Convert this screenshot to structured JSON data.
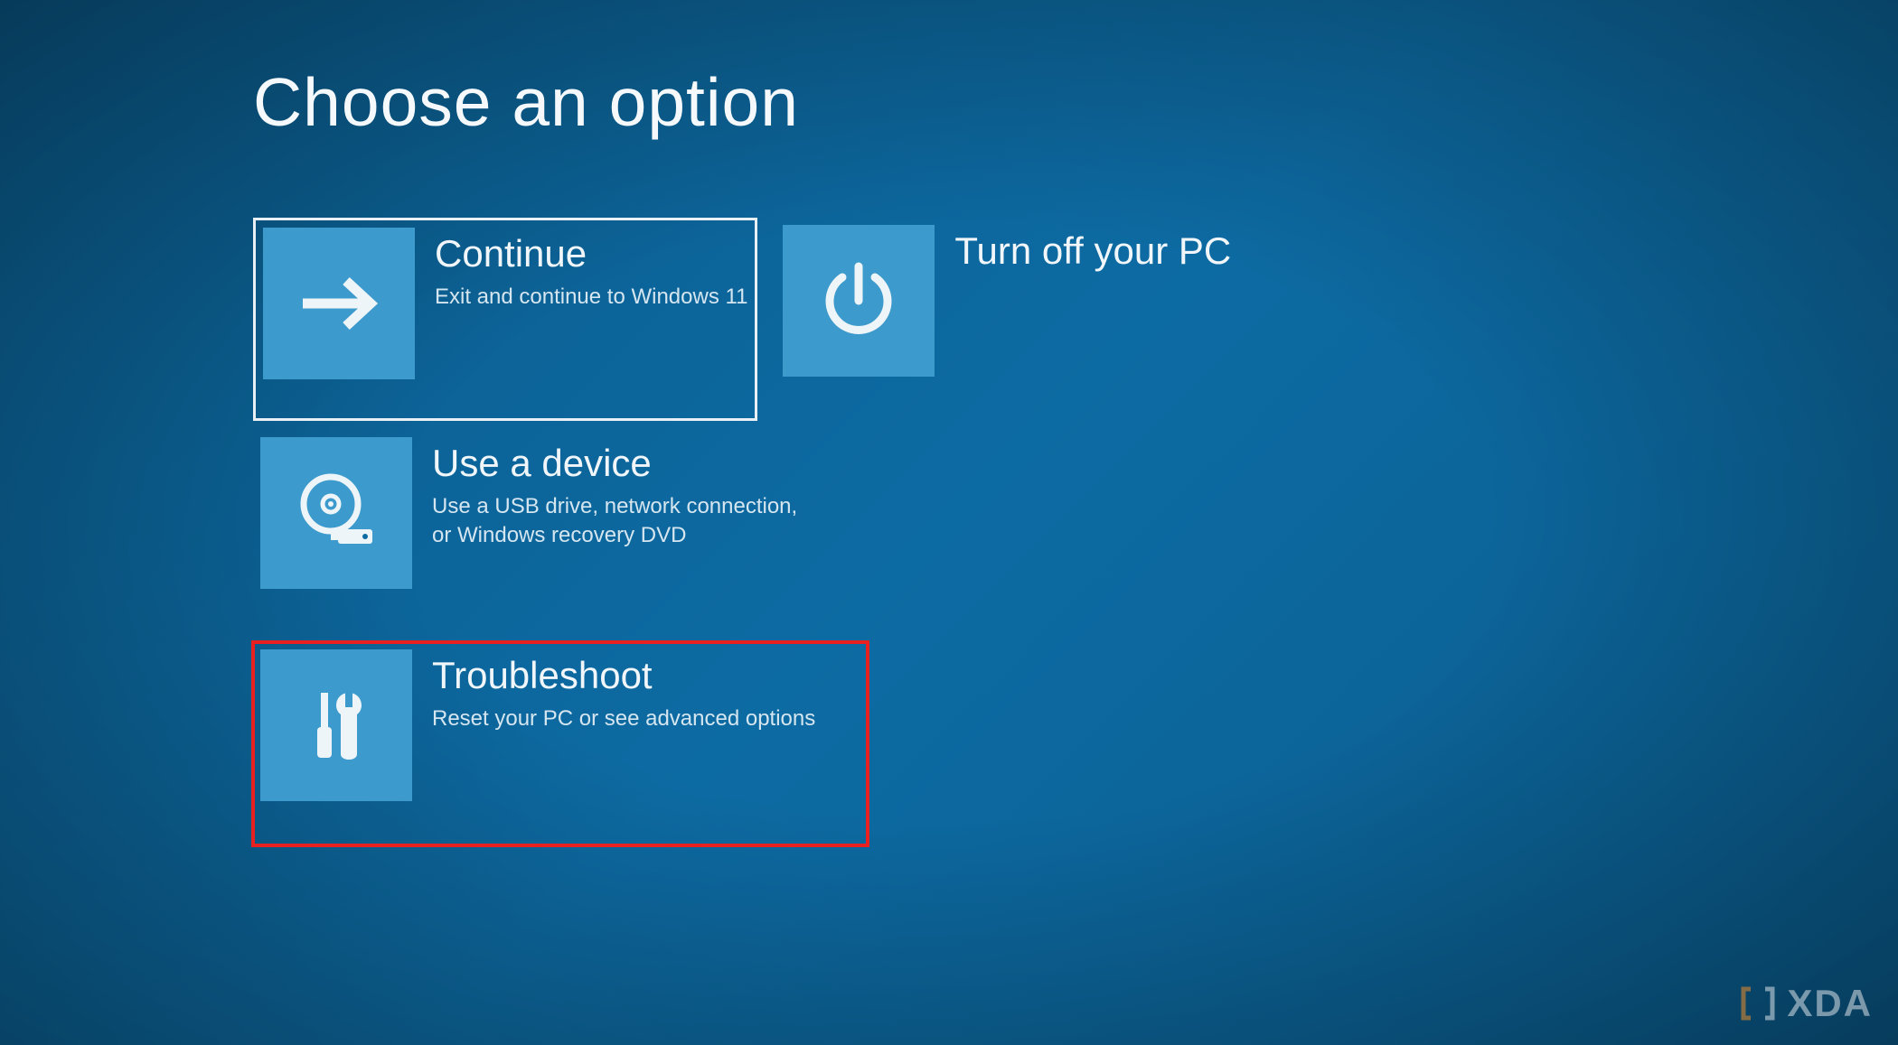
{
  "screen": {
    "title": "Choose an option"
  },
  "options": {
    "continue": {
      "title": "Continue",
      "desc": "Exit and continue to Windows 11",
      "icon": "arrow-right-icon",
      "selected": true
    },
    "turn_off": {
      "title": "Turn off your PC",
      "desc": "",
      "icon": "power-icon",
      "selected": false
    },
    "use_device": {
      "title": "Use a device",
      "desc": "Use a USB drive, network connection, or Windows recovery DVD",
      "icon": "disc-usb-icon",
      "selected": false
    },
    "troubleshoot": {
      "title": "Troubleshoot",
      "desc": "Reset your PC or see advanced options",
      "icon": "tools-icon",
      "selected": false,
      "highlighted": true
    }
  },
  "watermark": {
    "text": "XDA"
  },
  "colors": {
    "background": "#0d6ba3",
    "tile": "#3d9acc",
    "text": "#f0f6fa",
    "highlight": "#e82020"
  }
}
